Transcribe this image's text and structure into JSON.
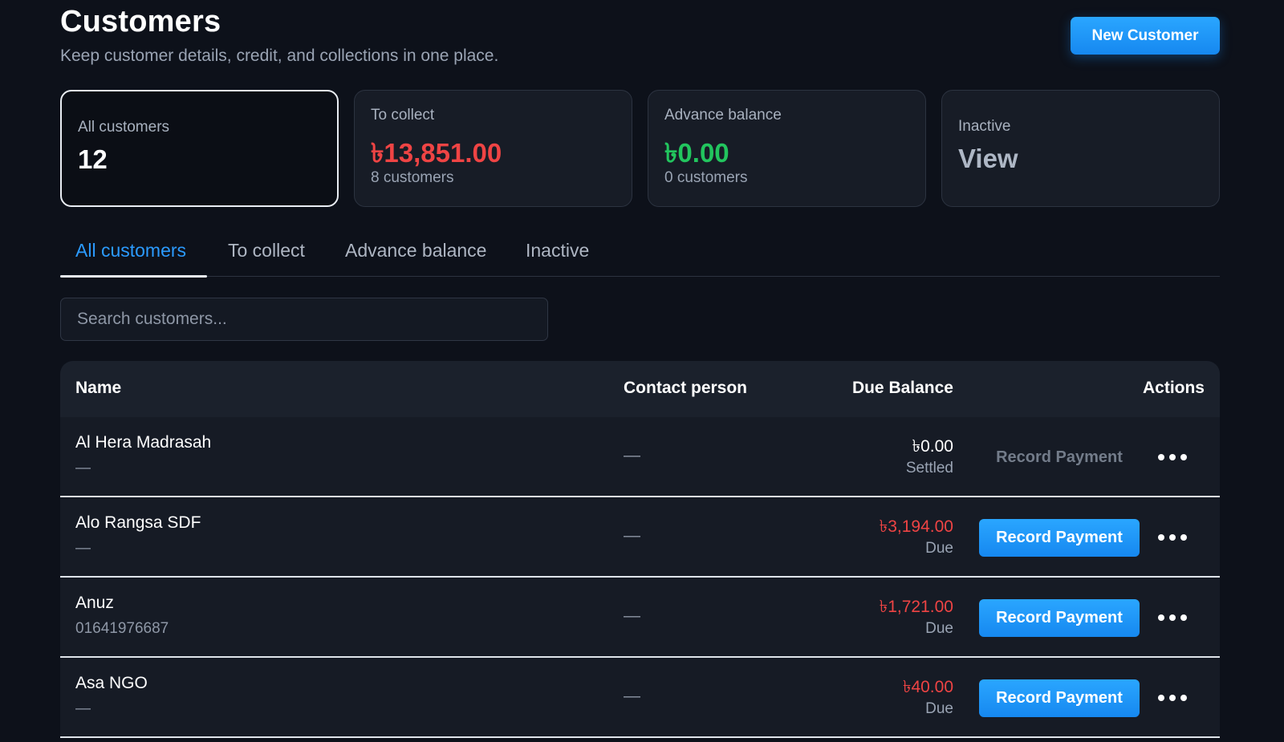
{
  "header": {
    "title": "Customers",
    "subtitle": "Keep customer details, credit, and collections in one place.",
    "new_button": "New Customer"
  },
  "cards": [
    {
      "label": "All customers",
      "value": "12",
      "sub": ""
    },
    {
      "label": "To collect",
      "value": "৳13,851.00",
      "sub": "8 customers"
    },
    {
      "label": "Advance balance",
      "value": "৳0.00",
      "sub": "0 customers"
    },
    {
      "label": "Inactive",
      "value": "View",
      "sub": ""
    }
  ],
  "tabs": [
    {
      "label": "All customers",
      "active": true
    },
    {
      "label": "To collect",
      "active": false
    },
    {
      "label": "Advance balance",
      "active": false
    },
    {
      "label": "Inactive",
      "active": false
    }
  ],
  "search": {
    "placeholder": "Search customers...",
    "value": ""
  },
  "table": {
    "columns": [
      "Name",
      "Contact person",
      "Due Balance",
      "Actions"
    ],
    "rows": [
      {
        "name": "Al Hera Madrasah",
        "phone": "—",
        "contact": "—",
        "amount": "৳0.00",
        "status": "Settled",
        "action": "Record Payment"
      },
      {
        "name": "Alo Rangsa SDF",
        "phone": "—",
        "contact": "—",
        "amount": "৳3,194.00",
        "status": "Due",
        "action": "Record Payment"
      },
      {
        "name": "Anuz",
        "phone": "01641976687",
        "contact": "—",
        "amount": "৳1,721.00",
        "status": "Due",
        "action": "Record Payment"
      },
      {
        "name": "Asa NGO",
        "phone": "—",
        "contact": "—",
        "amount": "৳40.00",
        "status": "Due",
        "action": "Record Payment"
      }
    ]
  },
  "colors": {
    "accent": "#1e96ff",
    "due": "#ef4444",
    "positive": "#22c55e",
    "background": "#0d111a"
  },
  "icons": {
    "more": "more-horizontal-icon"
  }
}
